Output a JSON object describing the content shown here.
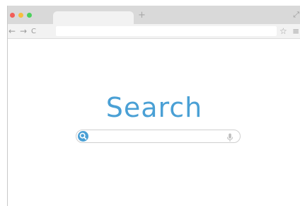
{
  "browser": {
    "new_tab_glyph": "+",
    "resize_glyph": "⤢",
    "nav": {
      "back_glyph": "←",
      "forward_glyph": "→",
      "reload_glyph": "C"
    },
    "address_bar": {
      "value": "",
      "placeholder": ""
    },
    "bookmark_glyph": "☆",
    "menu_glyph": "≡"
  },
  "page": {
    "logo_text": "Search",
    "search": {
      "value": "",
      "placeholder": ""
    }
  },
  "icons": {
    "window_controls": [
      "close-icon",
      "minimize-icon",
      "maximize-icon"
    ],
    "search_button": "magnifier-icon",
    "voice_button": "microphone-icon"
  },
  "colors": {
    "accent": "#4aa0d5",
    "close": "#f25d58",
    "minimize": "#f7be3d",
    "maximize": "#4bd05c",
    "titlebar": "#d9d9d9",
    "toolbar": "#f2f2f2"
  }
}
